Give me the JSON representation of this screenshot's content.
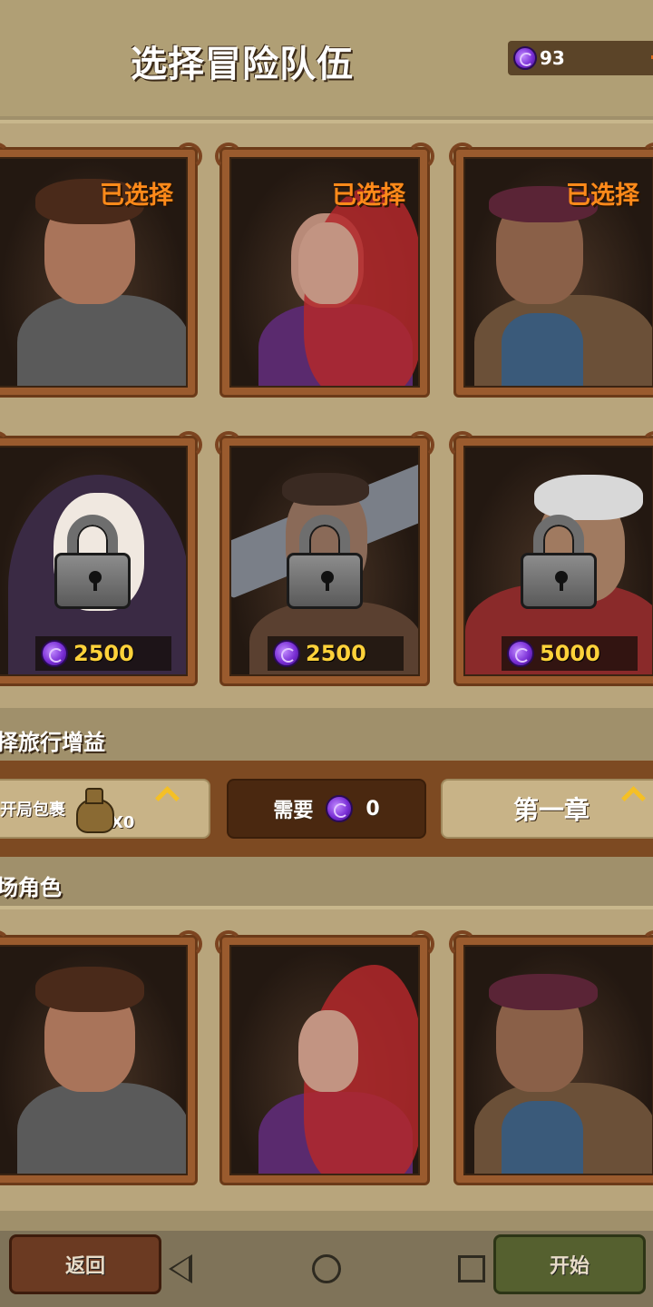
{
  "header": {
    "title": "选择冒险队伍",
    "gem_count": "93",
    "gem_icon": "purple-gem-icon"
  },
  "team_cards": [
    {
      "status": "已选择",
      "locked": false,
      "hair": "#4a2a1a",
      "outfit": "#5a5a5a"
    },
    {
      "status": "已选择",
      "locked": false,
      "hair": "#b3282b",
      "outfit": "#5a2a6e"
    },
    {
      "status": "已选择",
      "locked": false,
      "hair": "#5a2436",
      "outfit": "#3a5a7a"
    },
    {
      "price": "2500",
      "locked": true,
      "hair": "#f0e8e0",
      "outfit": "#3a2a44"
    },
    {
      "price": "2500",
      "locked": true,
      "hair": "#3a2a22",
      "outfit": "#7a7f88"
    },
    {
      "price": "5000",
      "locked": true,
      "hair": "#d8d8d8",
      "outfit": "#8a2a2a"
    }
  ],
  "buff_section": {
    "label": "择旅行增益",
    "pack_label": "开局包裹",
    "pack_count": "X0",
    "need_label": "需要",
    "need_value": "0",
    "chapter_label": "第一章"
  },
  "lineup_section": {
    "label": "场角色"
  },
  "lineup_cards": [
    {
      "hair": "#4a2a1a",
      "outfit": "#5a5a5a"
    },
    {
      "hair": "#b3282b",
      "outfit": "#5a2a6e"
    },
    {
      "hair": "#5a2436",
      "outfit": "#3a5a7a"
    }
  ],
  "footer": {
    "back_label": "返回",
    "start_label": "开始"
  }
}
